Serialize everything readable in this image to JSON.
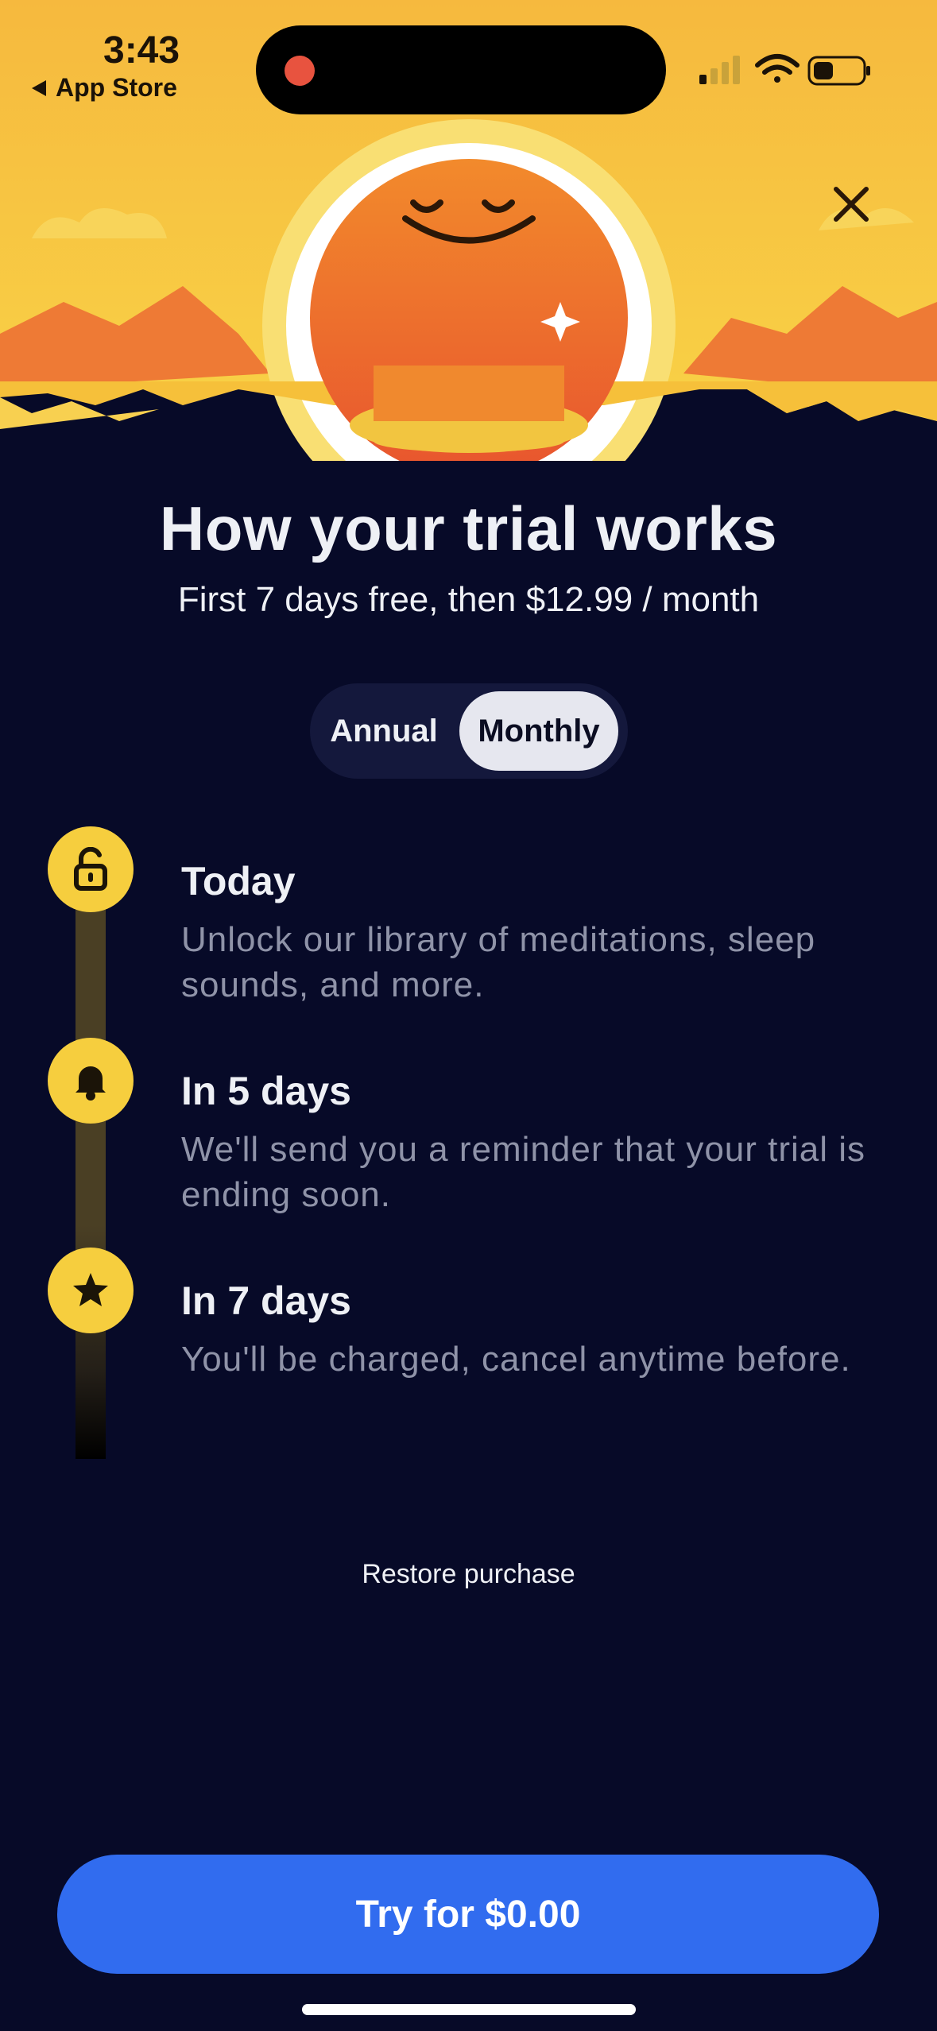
{
  "status_bar": {
    "time": "3:43",
    "back_label": "App Store"
  },
  "header": {
    "title": "How your trial works",
    "subtitle": "First 7 days free, then $12.99 / month"
  },
  "plan_toggle": {
    "options": [
      "Annual",
      "Monthly"
    ],
    "selected": "Monthly"
  },
  "timeline": [
    {
      "icon": "unlock-icon",
      "title": "Today",
      "description": "Unlock our library of meditations, sleep sounds, and more."
    },
    {
      "icon": "bell-icon",
      "title": "In 5 days",
      "description": "We'll send you a reminder that your trial is ending soon."
    },
    {
      "icon": "star-icon",
      "title": "In 7 days",
      "description": "You'll be charged, cancel anytime before."
    }
  ],
  "restore_label": "Restore purchase",
  "cta_label": "Try for $0.00",
  "colors": {
    "background": "#070a28",
    "accent_yellow": "#f6ce3e",
    "cta_blue": "#316cef",
    "sun_orange": "#ee6a2e"
  }
}
